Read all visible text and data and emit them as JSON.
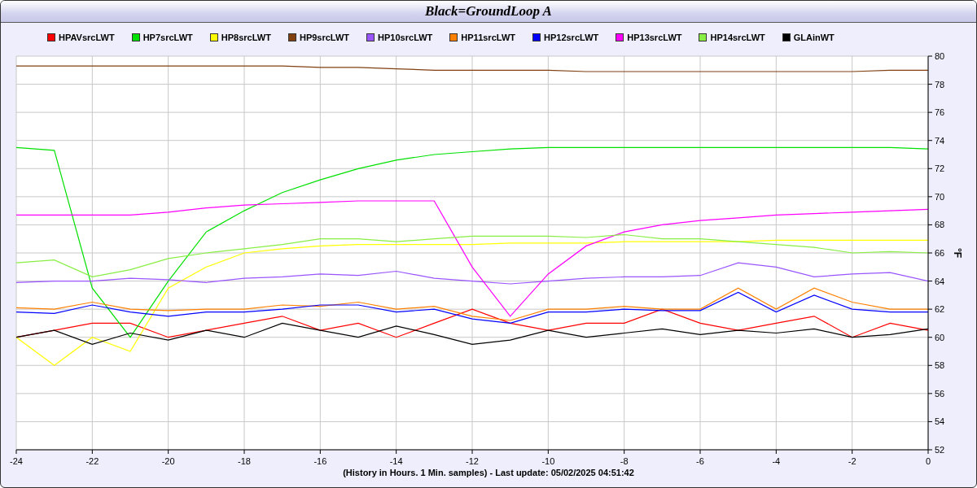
{
  "window": {
    "title": "Black=GroundLoop A"
  },
  "chart": {
    "chart_data": {
      "type": "line",
      "grid": true,
      "legend": "top",
      "xlabel": "(History in Hours. 1 Min. samples) - Last update: 05/02/2025 04:51:42",
      "ylabel": "°F",
      "x": [
        -24,
        -23,
        -22,
        -21,
        -20,
        -19,
        -18,
        -17,
        -16,
        -15,
        -14,
        -13,
        -12,
        -11,
        -10,
        -9,
        -8,
        -7,
        -6,
        -5,
        -4,
        -3,
        -2,
        -1,
        0
      ],
      "xlim": [
        -24,
        0
      ],
      "ylim": [
        52,
        80
      ],
      "xticks": [
        -24,
        -22,
        -20,
        -18,
        -16,
        -14,
        -12,
        -10,
        -8,
        -6,
        -4,
        -2,
        0
      ],
      "yticks": [
        52,
        54,
        56,
        58,
        60,
        62,
        64,
        66,
        68,
        70,
        72,
        74,
        76,
        78,
        80
      ],
      "series": [
        {
          "name": "HPAVsrcLWT",
          "color": "#ff0000",
          "values": [
            60,
            60.5,
            61,
            61,
            60,
            60.5,
            61,
            61.5,
            60.5,
            61,
            60,
            61,
            62,
            61,
            60.5,
            61,
            61,
            62,
            61,
            60.5,
            61,
            61.5,
            60,
            61,
            60.5
          ]
        },
        {
          "name": "HP7srcLWT",
          "color": "#00e000",
          "values": [
            73.5,
            73.3,
            63.5,
            60,
            64,
            67.5,
            69,
            70.3,
            71.2,
            72,
            72.6,
            73,
            73.2,
            73.4,
            73.5,
            73.5,
            73.5,
            73.5,
            73.5,
            73.5,
            73.5,
            73.5,
            73.5,
            73.5,
            73.4
          ]
        },
        {
          "name": "HP8srcLWT",
          "color": "#ffff00",
          "values": [
            60,
            58,
            60,
            59,
            63.5,
            65,
            66,
            66.3,
            66.5,
            66.6,
            66.6,
            66.6,
            66.6,
            66.7,
            66.7,
            66.7,
            66.8,
            66.8,
            66.8,
            66.8,
            66.9,
            66.9,
            66.9,
            66.9,
            66.9
          ]
        },
        {
          "name": "HP9srcLWT",
          "color": "#804010",
          "values": [
            79.3,
            79.3,
            79.3,
            79.3,
            79.3,
            79.3,
            79.3,
            79.3,
            79.2,
            79.2,
            79.1,
            79,
            79,
            79,
            79,
            78.9,
            78.9,
            78.9,
            78.9,
            78.9,
            78.9,
            78.9,
            78.9,
            79,
            79
          ]
        },
        {
          "name": "HP10srcLWT",
          "color": "#9955ff",
          "values": [
            63.9,
            64,
            64,
            64.2,
            64.1,
            63.9,
            64.2,
            64.3,
            64.5,
            64.4,
            64.7,
            64.2,
            64,
            63.8,
            64,
            64.2,
            64.3,
            64.3,
            64.4,
            65.3,
            65,
            64.3,
            64.5,
            64.6,
            64
          ]
        },
        {
          "name": "HP11srcLWT",
          "color": "#ff8000",
          "values": [
            62.1,
            62,
            62.5,
            62,
            61.9,
            62,
            62,
            62.3,
            62.2,
            62.5,
            62,
            62.2,
            61.5,
            61.2,
            62,
            62,
            62.2,
            62,
            62,
            63.5,
            62,
            63.5,
            62.5,
            62,
            62
          ]
        },
        {
          "name": "HP12srcLWT",
          "color": "#0000ff",
          "values": [
            61.8,
            61.7,
            62.3,
            61.8,
            61.5,
            61.8,
            61.8,
            62,
            62.3,
            62.3,
            61.8,
            62,
            61.3,
            61,
            61.8,
            61.8,
            62,
            61.9,
            61.9,
            63.2,
            61.8,
            63,
            62,
            61.8,
            61.8
          ]
        },
        {
          "name": "HP13srcLWT",
          "color": "#ff00ff",
          "values": [
            68.7,
            68.7,
            68.7,
            68.7,
            68.9,
            69.2,
            69.4,
            69.5,
            69.6,
            69.7,
            69.7,
            69.7,
            65,
            61.5,
            64.5,
            66.5,
            67.5,
            68,
            68.3,
            68.5,
            68.7,
            68.8,
            68.9,
            69,
            69.1
          ]
        },
        {
          "name": "HP14srcLWT",
          "color": "#88ee44",
          "values": [
            65.3,
            65.5,
            64.3,
            64.8,
            65.6,
            66,
            66.3,
            66.6,
            67,
            67,
            66.8,
            67,
            67.2,
            67.2,
            67.2,
            67.1,
            67.3,
            67,
            67,
            66.8,
            66.6,
            66.4,
            66,
            66.1,
            66
          ]
        },
        {
          "name": "GLAinWT",
          "color": "#000000",
          "values": [
            60,
            60.5,
            59.5,
            60.3,
            59.8,
            60.5,
            60,
            61,
            60.5,
            60,
            60.8,
            60.2,
            59.5,
            59.8,
            60.5,
            60,
            60.3,
            60.6,
            60.2,
            60.5,
            60.3,
            60.6,
            60,
            60.2,
            60.6
          ]
        }
      ]
    }
  }
}
